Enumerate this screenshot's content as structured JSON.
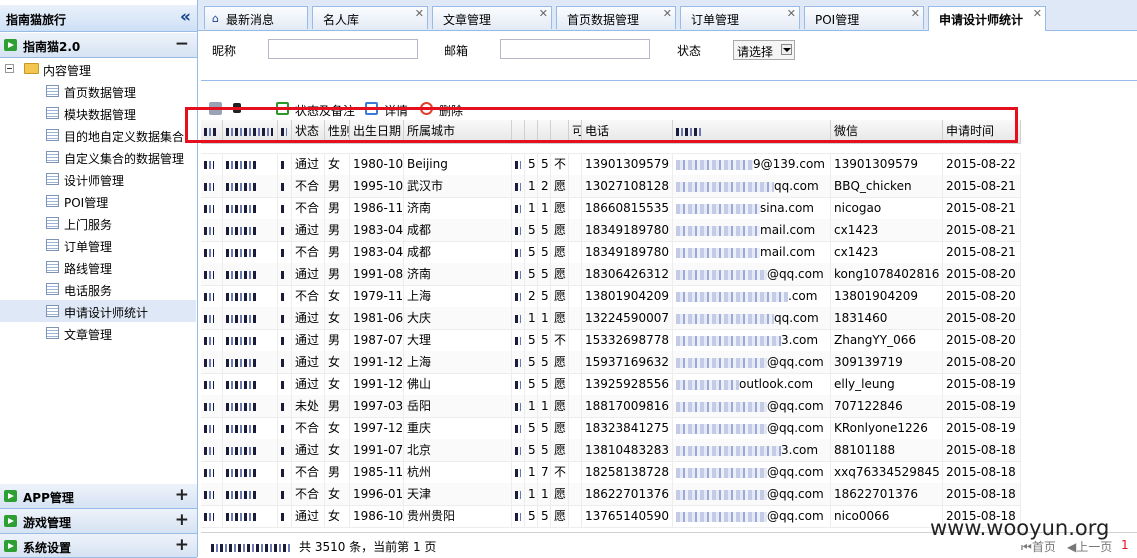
{
  "sidebar": {
    "title": "指南猫旅行",
    "sections": [
      {
        "label": "指南猫2.0",
        "toggle": "−"
      },
      {
        "label": "APP管理",
        "toggle": "+"
      },
      {
        "label": "游戏管理",
        "toggle": "+"
      },
      {
        "label": "系统设置",
        "toggle": "+"
      }
    ],
    "folder": "内容管理",
    "items": [
      "首页数据管理",
      "模块数据管理",
      "目的地自定义数据集合",
      "自定义集合的数据管理",
      "设计师管理",
      "POI管理",
      "上门服务",
      "订单管理",
      "路线管理",
      "电话服务",
      "申请设计师统计",
      "文章管理"
    ],
    "selected_index": 10
  },
  "tabs": [
    {
      "label": "最新消息",
      "closable": false,
      "home": true
    },
    {
      "label": "名人库",
      "closable": true
    },
    {
      "label": "文章管理",
      "closable": true
    },
    {
      "label": "首页数据管理",
      "closable": true
    },
    {
      "label": "订单管理",
      "closable": true
    },
    {
      "label": "POI管理",
      "closable": true
    },
    {
      "label": "申请设计师统计",
      "closable": true,
      "active": true
    }
  ],
  "search": {
    "nickname_label": "昵称",
    "email_label": "邮箱",
    "status_label": "状态",
    "status_value": "请选择"
  },
  "toolbar": {
    "status_btn": "状态及备注",
    "detail_btn": "详情",
    "delete_btn": "删除"
  },
  "grid": {
    "headers": [
      "状态",
      "性别",
      "出生日期",
      "所属城市",
      "",
      "",
      "",
      "",
      "可",
      "电话",
      "",
      "微信",
      "",
      "申请时间"
    ],
    "rows": [
      [
        "通过",
        "女",
        "1980-10-",
        "Beijing",
        "5",
        "5",
        "不",
        "13901309579",
        "9@139.com",
        "13901309579",
        "2015-08-22"
      ],
      [
        "不合",
        "男",
        "1995-10-",
        "武汉市",
        "1",
        "2",
        "愿",
        "13027108128",
        "qq.com",
        "BBQ_chicken",
        "2015-08-21"
      ],
      [
        "不合",
        "男",
        "1986-11-",
        "济南",
        "1",
        "1",
        "愿",
        "18660815535",
        "sina.com",
        "nicogao",
        "2015-08-21"
      ],
      [
        "通过",
        "男",
        "1983-04-",
        "成都",
        "5",
        "5",
        "愿",
        "18349189780",
        "mail.com",
        "cx1423",
        "2015-08-21"
      ],
      [
        "不合",
        "男",
        "1983-04-",
        "成都",
        "5",
        "5",
        "愿",
        "18349189780",
        "mail.com",
        "cx1423",
        "2015-08-21"
      ],
      [
        "通过",
        "男",
        "1991-08-",
        "济南",
        "5",
        "5",
        "愿",
        "18306426312",
        "@qq.com",
        "kong1078402816",
        "2015-08-20"
      ],
      [
        "不合",
        "女",
        "1979-11-",
        "上海",
        "2",
        "5",
        "愿",
        "13801904209",
        ".com",
        "13801904209",
        "2015-08-20"
      ],
      [
        "通过",
        "女",
        "1981-06-",
        "大庆",
        "1",
        "1",
        "愿",
        "13224590007",
        "qq.com",
        "1831460",
        "2015-08-20"
      ],
      [
        "通过",
        "男",
        "1987-07-",
        "大理",
        "5",
        "5",
        "不",
        "15332698778",
        "3.com",
        "ZhangYY_066",
        "2015-08-20"
      ],
      [
        "通过",
        "女",
        "1991-12-",
        "上海",
        "5",
        "5",
        "愿",
        "15937169632",
        "@qq.com",
        "309139719",
        "2015-08-20"
      ],
      [
        "通过",
        "女",
        "1991-12-",
        "佛山",
        "5",
        "5",
        "愿",
        "13925928556",
        "outlook.com",
        "elly_leung",
        "2015-08-19"
      ],
      [
        "未处",
        "男",
        "1997-03-",
        "岳阳",
        "1",
        "1",
        "愿",
        "18817009816",
        "@qq.com",
        "707122846",
        "2015-08-19"
      ],
      [
        "不合",
        "女",
        "1997-12-",
        "重庆",
        "5",
        "5",
        "愿",
        "18323841275",
        "@qq.com",
        "KRonlyone1226",
        "2015-08-19"
      ],
      [
        "通过",
        "女",
        "1991-07-",
        "北京",
        "5",
        "5",
        "愿",
        "13810483283",
        "3.com",
        "88101188",
        "2015-08-18"
      ],
      [
        "不合",
        "男",
        "1985-11-",
        "杭州",
        "1",
        "7",
        "不",
        "18258138728",
        "@qq.com",
        "xxq76334529845",
        "2015-08-18"
      ],
      [
        "不合",
        "女",
        "1996-01-",
        "天津",
        "1",
        "1",
        "愿",
        "18622701376",
        "@qq.com",
        "18622701376",
        "2015-08-18"
      ],
      [
        "通过",
        "女",
        "1986-10-",
        "贵州贵阳",
        "5",
        "5",
        "愿",
        "13765140590",
        "@qq.com",
        "nico0066",
        "2015-08-18"
      ]
    ]
  },
  "pager": {
    "summary": "共 3510 条，当前第 1 页",
    "first": "首页",
    "prev": "上一页",
    "page_num": "1"
  },
  "watermark": "www.wooyun.org",
  "colors": {
    "highlight": "#e4101d",
    "accent": "#15428b",
    "border": "#99bbe8"
  }
}
